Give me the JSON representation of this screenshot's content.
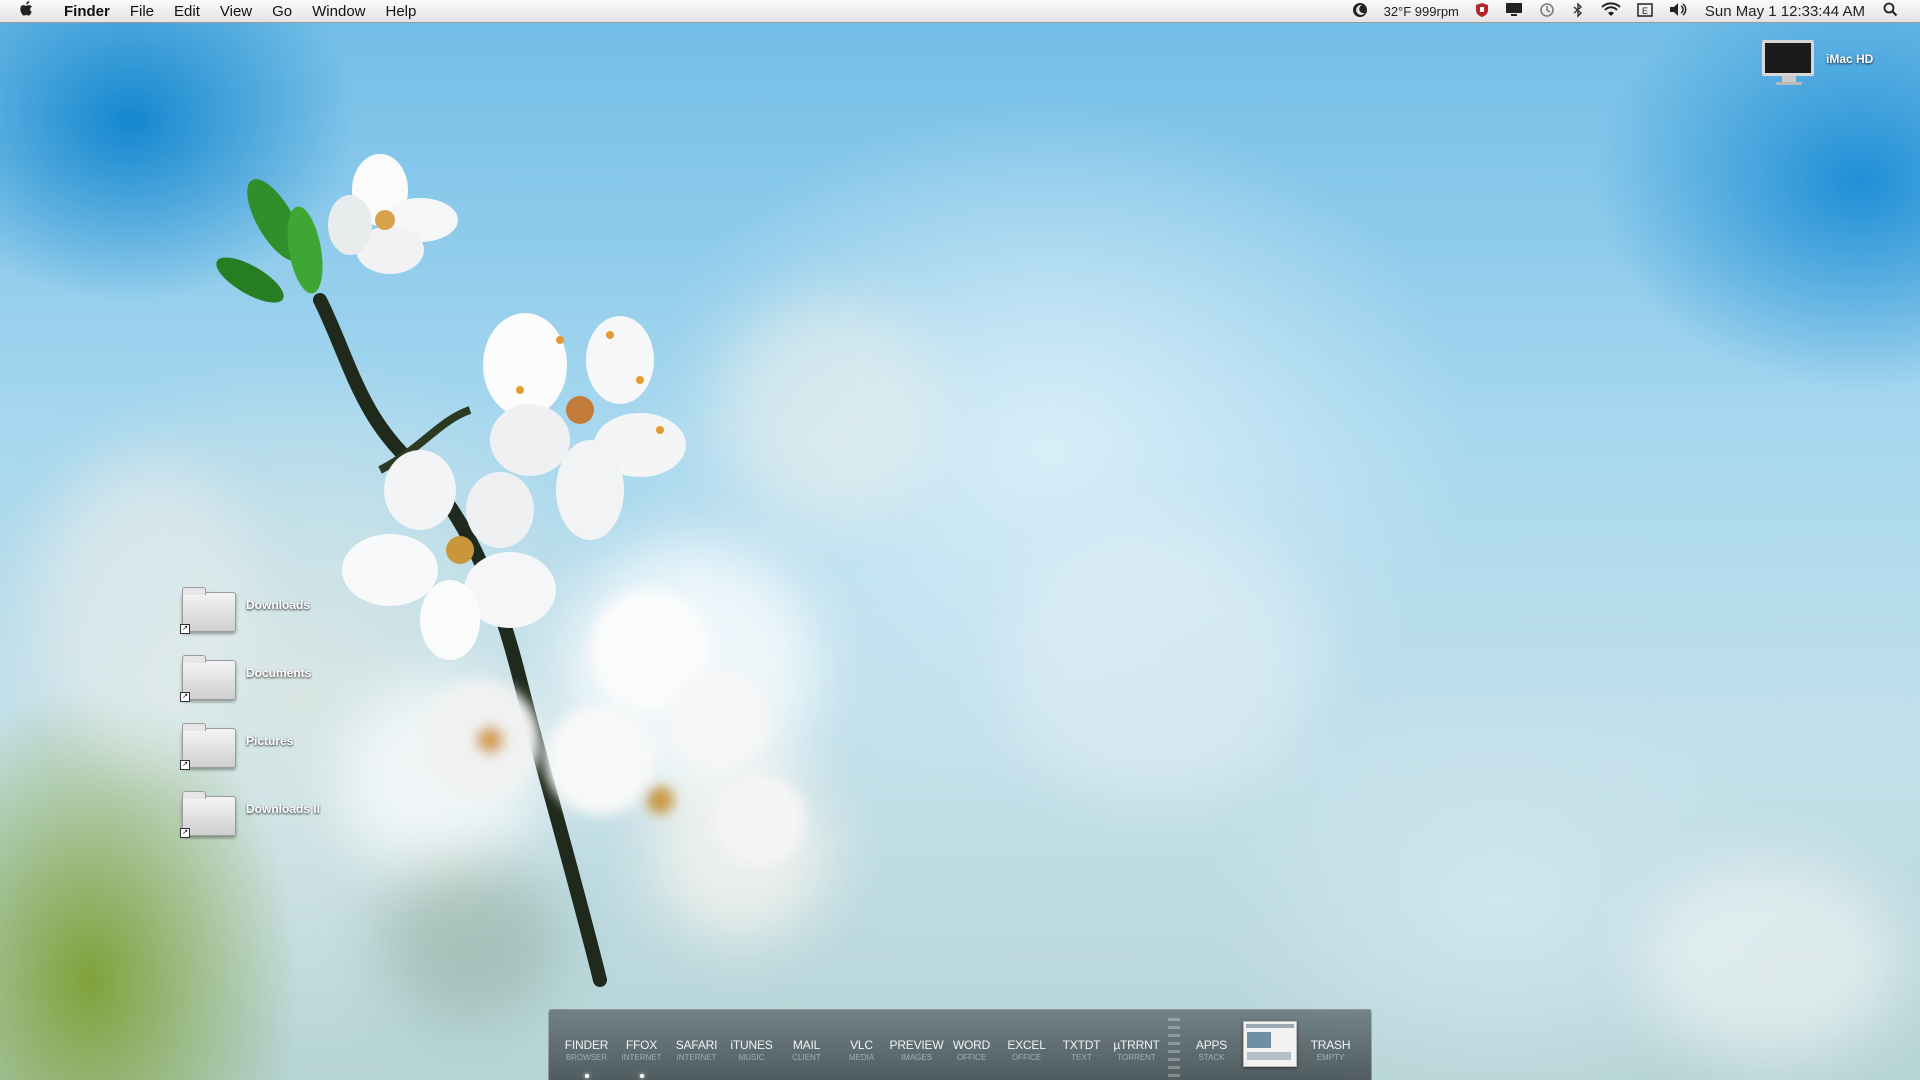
{
  "menubar": {
    "apple": "",
    "app_name": "Finder",
    "menus": [
      "File",
      "Edit",
      "View",
      "Go",
      "Window",
      "Help"
    ],
    "status_text": "32°F 999rpm",
    "clock": "Sun May 1  12:33:44 AM",
    "extras": [
      "moon-app-icon",
      "shield-icon",
      "display-icon",
      "time-machine-icon",
      "bluetooth-icon",
      "wifi-icon",
      "input-menu-icon",
      "volume-icon",
      "spotlight-icon"
    ]
  },
  "desktop": {
    "drive_label": "iMac HD",
    "folders": [
      "Downloads",
      "Documents",
      "Pictures",
      "Downloads  II"
    ]
  },
  "dock": {
    "items": [
      {
        "name": "FINDER",
        "sub": "BROWSER",
        "running": true
      },
      {
        "name": "FFOX",
        "sub": "INTERNET",
        "running": true
      },
      {
        "name": "SAFARI",
        "sub": "INTERNET",
        "running": false
      },
      {
        "name": "iTUNES",
        "sub": "MUSIC",
        "running": false
      },
      {
        "name": "MAIL",
        "sub": "CLIENT",
        "running": false
      },
      {
        "name": "VLC",
        "sub": "MEDIA",
        "running": false
      },
      {
        "name": "PREVIEW",
        "sub": "IMAGES",
        "running": false
      },
      {
        "name": "WORD",
        "sub": "OFFICE",
        "running": false
      },
      {
        "name": "EXCEL",
        "sub": "OFFICE",
        "running": false
      },
      {
        "name": "TXTDT",
        "sub": "TEXT",
        "running": false
      },
      {
        "name": "µTRRNT",
        "sub": "TORRENT",
        "running": false
      }
    ],
    "apps": {
      "name": "APPS",
      "sub": "STACK"
    },
    "trash": {
      "name": "TRASH",
      "sub": "EMPTY"
    }
  }
}
